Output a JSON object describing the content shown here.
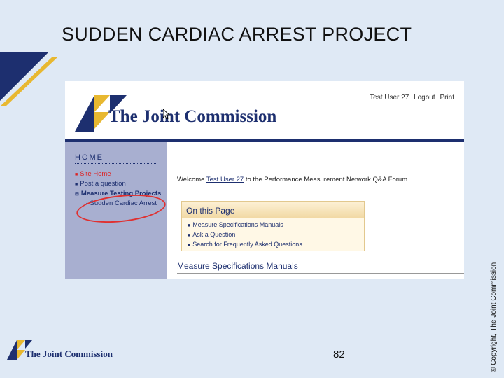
{
  "slide": {
    "title": "SUDDEN CARDIAC ARREST PROJECT",
    "copyright": "© Copyright, The Joint Commission",
    "footer_brand": "The Joint Commission",
    "page_number": "82"
  },
  "site": {
    "brand": "The Joint Commission",
    "user_links": [
      "Test User 27",
      "Logout",
      "Print"
    ]
  },
  "sidebar": {
    "heading": "HOME",
    "items": [
      {
        "label": "Site Home"
      },
      {
        "label": "Post a question"
      },
      {
        "label": "Measure Testing Projects"
      },
      {
        "label": "Sudden Cardiac Arrest"
      }
    ]
  },
  "main": {
    "welcome_prefix": "Welcome",
    "welcome_user": "Test User 27",
    "welcome_suffix": "to the Performance Measurement Network Q&A Forum",
    "on_this_page": {
      "heading": "On this Page",
      "items": [
        "Measure Specifications Manuals",
        "Ask a Question",
        "Search for Frequently Asked Questions"
      ]
    },
    "section_heading": "Measure Specifications Manuals"
  },
  "colors": {
    "brand_navy": "#1d2f6f",
    "brand_gold": "#e8b830",
    "slide_bg": "#dfe9f5",
    "sidebar_bg": "#a8afd0",
    "highlight_red": "#e03030"
  }
}
